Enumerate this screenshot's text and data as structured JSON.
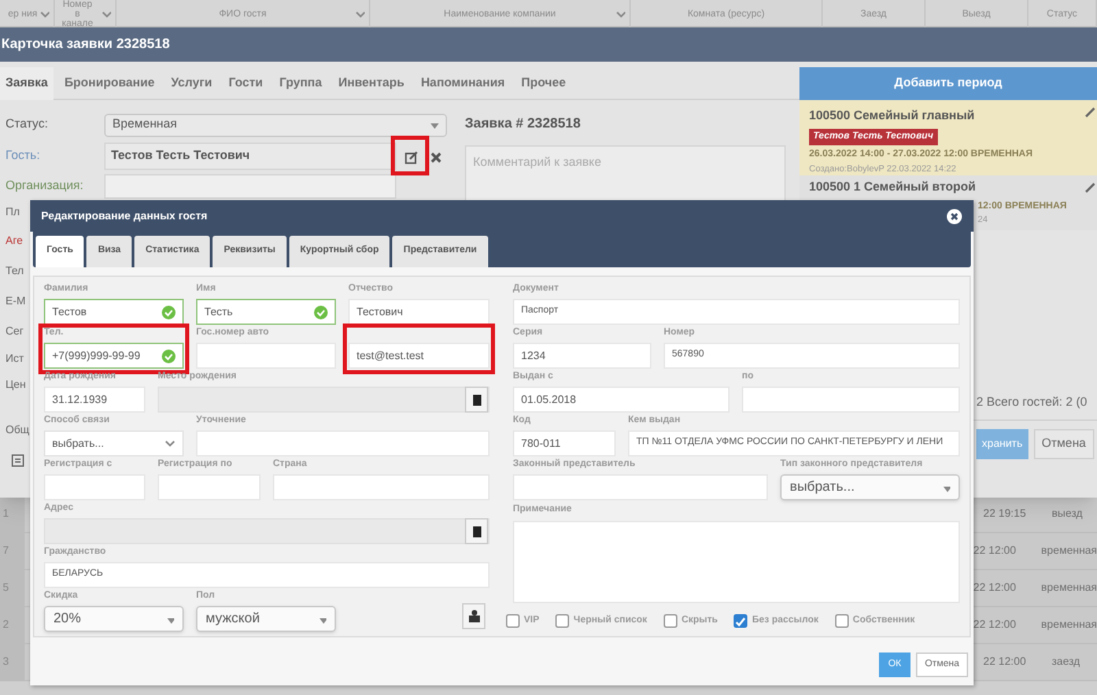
{
  "grid": {
    "columns": [
      "ер ния",
      "Номер в канале",
      "ФИО гостя",
      "Наименование компании",
      "Комната (ресурс)",
      "Заезд",
      "Выезд",
      "Статус"
    ],
    "rows": [
      {
        "number": "1",
        "time": "22 19:15",
        "status": "выезд"
      },
      {
        "number": "7",
        "time": "22 12:00",
        "status": "временная"
      },
      {
        "number": "5",
        "time": "22 12:00",
        "status": "временная"
      },
      {
        "number": "2",
        "time": "22 12:00",
        "status": "временная"
      },
      {
        "number": "3",
        "time": "22 12:00",
        "status": "заезд"
      }
    ]
  },
  "booking_card": {
    "title": "Карточка заявки 2328518",
    "tabs": [
      {
        "label": "Заявка",
        "selected": true
      },
      {
        "label": "Бронирование",
        "selected": false
      },
      {
        "label": "Услуги",
        "selected": false
      },
      {
        "label": "Гости",
        "selected": false
      },
      {
        "label": "Группа",
        "selected": false
      },
      {
        "label": "Инвентарь",
        "selected": false
      },
      {
        "label": "Напоминания",
        "selected": false
      },
      {
        "label": "Прочее",
        "selected": false
      }
    ],
    "status": {
      "label": "Статус:",
      "value": "Временная"
    },
    "guest": {
      "label": "Гость:",
      "value": "Тестов Тесть Тестович",
      "edit_highlighted": true
    },
    "organization": {
      "label": "Организация:"
    },
    "covered_labels": [
      {
        "text": "Пл",
        "kind": "plain"
      },
      {
        "text": "Аге",
        "kind": "alert"
      },
      {
        "text": "Тел",
        "kind": "plain"
      },
      {
        "text": "E-M",
        "kind": "plain"
      },
      {
        "text": "Сег",
        "kind": "plain"
      },
      {
        "text": "Ист",
        "kind": "plain"
      },
      {
        "text": "Цен",
        "kind": "plain"
      },
      {
        "text": "Общ",
        "kind": "plain"
      }
    ],
    "request_title": "Заявка # 2328518",
    "comment": {
      "placeholder": "Комментарий к заявке"
    },
    "add_period_button": "Добавить период",
    "periods": [
      {
        "kind": "full",
        "highlighted": true,
        "title": "100500 Семейный главный",
        "guest": "Тестов Тесть Тестович",
        "dates": "26.03.2022 14:00 - 27.03.2022 12:00 ВРЕМЕННАЯ",
        "created": "Создано:BobylevP 22.03.2022 14:22"
      },
      {
        "kind": "covered",
        "highlighted": false,
        "title": "100500 1 Семейный второй",
        "dates": "12:00 ВРЕМЕННАЯ",
        "created": "24"
      }
    ],
    "guest_total": "2 Всего гостей: 2 (0",
    "save_button": "хранить",
    "cancel_button": "Отмена"
  },
  "guest_dialog": {
    "title": "Редактирование данных гостя",
    "tabs": [
      {
        "label": "Гость",
        "selected": true
      },
      {
        "label": "Виза",
        "selected": false
      },
      {
        "label": "Статистика",
        "selected": false
      },
      {
        "label": "Реквизиты",
        "selected": false
      },
      {
        "label": "Курортный сбор",
        "selected": false
      },
      {
        "label": "Представители",
        "selected": false
      }
    ],
    "left_rows": [
      [
        {
          "kind": "text",
          "label": "Фамилия",
          "value": "Тестов",
          "valid": true,
          "highlighted": false
        },
        {
          "kind": "text",
          "label": "Имя",
          "value": "Тесть",
          "valid": true,
          "highlighted": false
        },
        {
          "kind": "text",
          "label": "Отчество",
          "value": "Тестович",
          "valid": false,
          "highlighted": false
        }
      ],
      [
        {
          "kind": "text",
          "label": "Тел.",
          "value": "+7(999)999-99-99",
          "valid": true,
          "highlighted": true
        },
        {
          "kind": "text",
          "label": "Гос.номер авто",
          "valid": false,
          "highlighted": false
        },
        {
          "kind": "text",
          "value": "test@test.test",
          "valid": false,
          "highlighted": true
        }
      ],
      [
        {
          "kind": "text",
          "label": "Дата рождения",
          "value": "31.12.1939",
          "valid": false,
          "highlighted": false
        },
        {
          "kind": "lookup",
          "label": "Место рождения",
          "highlighted": false
        }
      ],
      [
        {
          "kind": "dropdown",
          "label": "Способ связи",
          "value": "выбрать...",
          "highlighted": false
        },
        {
          "kind": "text",
          "label": "Уточнение",
          "valid": false,
          "highlighted": false
        }
      ],
      [
        {
          "kind": "text",
          "label": "Регистрация с",
          "valid": false,
          "highlighted": false
        },
        {
          "kind": "text",
          "label": "Регистрация по",
          "valid": false,
          "highlighted": false
        },
        {
          "kind": "text",
          "label": "Страна",
          "valid": false,
          "highlighted": false
        }
      ],
      [
        {
          "kind": "lookup",
          "label": "Адрес",
          "highlighted": false
        }
      ],
      [
        {
          "kind": "text",
          "label": "Гражданство",
          "value": "БЕЛАРУСЬ",
          "valid": false,
          "highlighted": false
        }
      ],
      [
        {
          "kind": "select",
          "label": "Скидка",
          "value": "20%",
          "highlighted": false
        },
        {
          "kind": "select",
          "label": "Пол",
          "value": "мужской",
          "highlighted": false
        }
      ]
    ],
    "right_rows": [
      [
        {
          "kind": "text",
          "label": "Документ",
          "value": "Паспорт",
          "valid": false,
          "highlighted": false
        }
      ],
      [
        {
          "kind": "text",
          "label": "Серия",
          "value": "1234",
          "valid": false,
          "highlighted": false
        },
        {
          "kind": "text",
          "label": "Номер",
          "value": "567890",
          "valid": false,
          "highlighted": false
        }
      ],
      [
        {
          "kind": "text",
          "label": "Выдан с",
          "value": "01.05.2018",
          "valid": false,
          "highlighted": false
        },
        {
          "kind": "text",
          "label": "по",
          "valid": false,
          "highlighted": false
        }
      ],
      [
        {
          "kind": "text",
          "label": "Код",
          "value": "780-011",
          "valid": false,
          "highlighted": false
        },
        {
          "kind": "text",
          "label": "Кем выдан",
          "value": "ТП №11 ОТДЕЛА УФМС РОССИИ ПО САНКТ-ПЕТЕРБУРГУ И ЛЕНИ",
          "valid": false,
          "highlighted": false
        }
      ],
      [
        {
          "kind": "text",
          "label": "Законный представитель",
          "valid": false,
          "highlighted": false
        },
        {
          "kind": "select",
          "label": "Тип законного представителя",
          "value": "выбрать...",
          "highlighted": false
        }
      ]
    ],
    "note": {
      "label": "Примечание"
    },
    "flags": [
      {
        "label": "VIP",
        "checked": false
      },
      {
        "label": "Черный список",
        "checked": false
      },
      {
        "label": "Скрыть",
        "checked": false
      },
      {
        "label": "Без рассылок",
        "checked": true
      },
      {
        "label": "Собственник",
        "checked": false
      }
    ],
    "ok_button": "ОК",
    "cancel_button": "Отмена"
  }
}
